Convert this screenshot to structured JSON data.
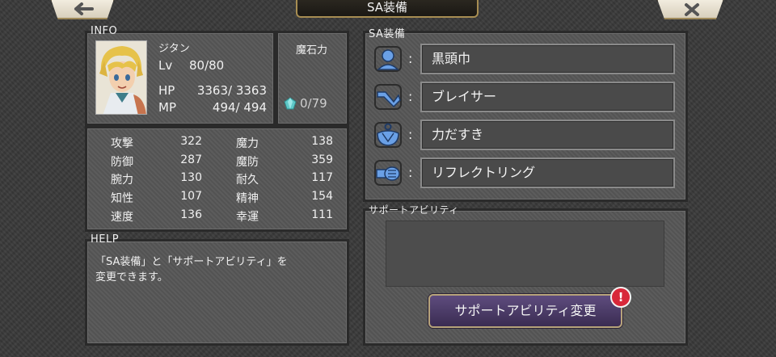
{
  "header": {
    "title": "SA装備",
    "back_icon": "back-arrow-icon",
    "close_icon": "close-icon"
  },
  "info": {
    "label": "INFO",
    "name": "ジタン",
    "lv_label": "Lv",
    "lv_value": "80/80",
    "hp_label": "HP",
    "hp_value": "3363/ 3363",
    "mp_label": "MP",
    "mp_value": "494/  494",
    "magicite_label": "魔石力",
    "magicite_value": "0/79"
  },
  "stats": [
    {
      "label": "攻撃",
      "value": "322"
    },
    {
      "label": "防御",
      "value": "287"
    },
    {
      "label": "腕力",
      "value": "130"
    },
    {
      "label": "知性",
      "value": "107"
    },
    {
      "label": "速度",
      "value": "136"
    },
    {
      "label": "魔力",
      "value": "138"
    },
    {
      "label": "魔防",
      "value": "359"
    },
    {
      "label": "耐久",
      "value": "117"
    },
    {
      "label": "精神",
      "value": "154"
    },
    {
      "label": "幸運",
      "value": "111"
    }
  ],
  "help": {
    "label": "HELP",
    "line1": "「SA装備」と「サポートアビリティ」を",
    "line2": "変更できます。"
  },
  "sa": {
    "label": "SA装備",
    "colon": ":",
    "slots": [
      {
        "icon": "head-icon",
        "name": "黒頭巾"
      },
      {
        "icon": "arm-icon",
        "name": "ブレイサー"
      },
      {
        "icon": "body-icon",
        "name": "力だすき"
      },
      {
        "icon": "accessory-icon",
        "name": "リフレクトリング"
      }
    ]
  },
  "support": {
    "label": "サポートアビリティ",
    "button": "サポートアビリティ変更",
    "alert": "!"
  },
  "colors": {
    "panel": "#565656",
    "slot": "#4a4a4a",
    "icon": "#5a8fd8",
    "button": "#4a3a64",
    "alert": "#d8283a"
  }
}
